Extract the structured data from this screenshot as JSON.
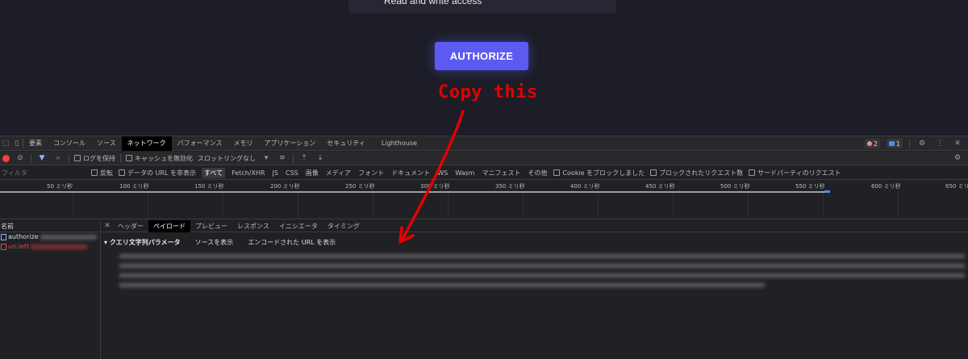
{
  "web": {
    "perm_text": "Read and write access",
    "authorize_label": "AUTHORIZE",
    "annotation": "Copy this",
    "annotation_color": "#e40000",
    "button_color": "#5b5bf2"
  },
  "devtools": {
    "tabs": [
      "要素",
      "コンソール",
      "ソース",
      "ネットワーク",
      "パフォーマンス",
      "メモリ",
      "アプリケーション",
      "セキュリティ",
      "Lighthouse"
    ],
    "active_tab": "ネットワーク",
    "error_count": "2",
    "message_count": "1",
    "toolbar": {
      "preserve_log": "ログを保持",
      "disable_cache": "キャッシュを無効化",
      "throttling": "スロットリングなし"
    },
    "filter": {
      "placeholder": "フィルタ",
      "invert": "反転",
      "hide_data_urls": "データの URL を非表示",
      "types": [
        "すべて",
        "Fetch/XHR",
        "JS",
        "CSS",
        "画像",
        "メディア",
        "フォント",
        "ドキュメント",
        "WS",
        "Wasm",
        "マニフェスト",
        "その他"
      ],
      "blocked_cookies": "Cookie をブロックしました",
      "blocked_requests": "ブロックされたリクエスト数",
      "third_party": "サードパーティのリクエスト"
    },
    "timeline_ticks": [
      "50 ミリ秒",
      "100 ミリ秒",
      "150 ミリ秒",
      "200 ミリ秒",
      "250 ミリ秒",
      "300 ミリ秒",
      "350 ミリ秒",
      "400 ミリ秒",
      "450 ミリ秒",
      "500 ミリ秒",
      "550 ミリ秒",
      "600 ミリ秒",
      "650 ミリ秒"
    ],
    "name_header": "名前",
    "requests": [
      "authorize",
      "un:iett"
    ],
    "detail_tabs": [
      "ヘッダー",
      "ペイロード",
      "プレビュー",
      "レスポンス",
      "イニシエータ",
      "タイミング"
    ],
    "active_detail_tab": "ペイロード",
    "payload": {
      "section_title": "クエリ文字列パラメータ",
      "view_source": "ソースを表示",
      "view_encoded": "エンコードされた URL を表示"
    }
  }
}
